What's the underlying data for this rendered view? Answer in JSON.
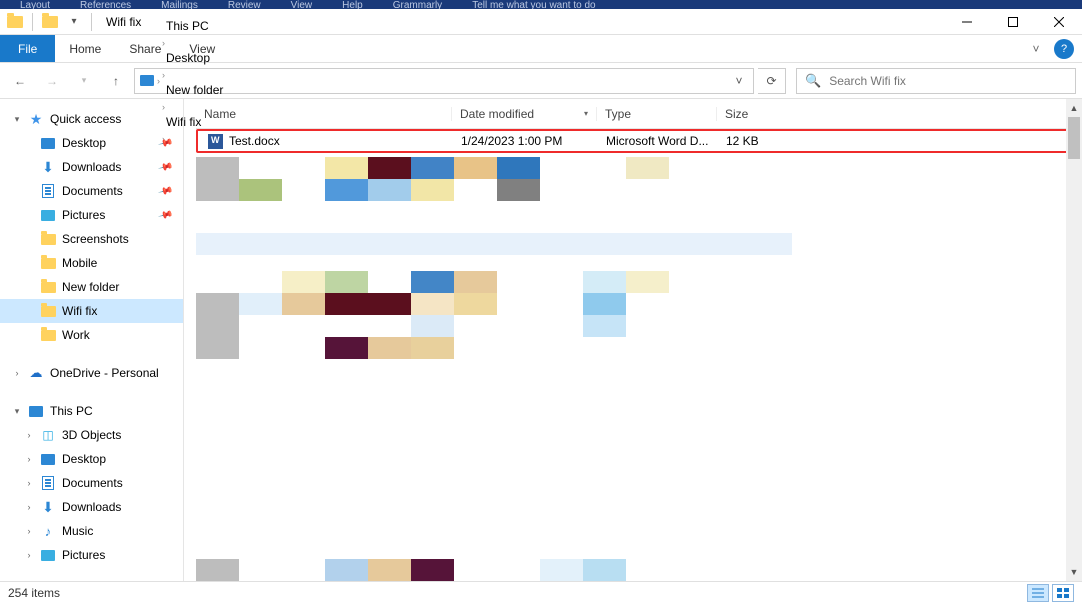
{
  "word_ribbon": [
    "Layout",
    "References",
    "Mailings",
    "Review",
    "View",
    "Help",
    "Grammarly",
    "Tell me what you want to do"
  ],
  "titlebar": {
    "title": "Wifi fix"
  },
  "ribbon": {
    "file": "File",
    "tabs": [
      "Home",
      "Share",
      "View"
    ]
  },
  "breadcrumbs": [
    "This PC",
    "Desktop",
    "New folder",
    "Wifi fix"
  ],
  "search": {
    "placeholder": "Search Wifi fix"
  },
  "nav": {
    "quick_access": "Quick access",
    "qa_items": [
      {
        "label": "Desktop",
        "pin": true,
        "ico": "desk"
      },
      {
        "label": "Downloads",
        "pin": true,
        "ico": "dl"
      },
      {
        "label": "Documents",
        "pin": true,
        "ico": "doc"
      },
      {
        "label": "Pictures",
        "pin": true,
        "ico": "pic"
      },
      {
        "label": "Screenshots",
        "pin": false,
        "ico": "folder"
      },
      {
        "label": "Mobile",
        "pin": false,
        "ico": "folder"
      },
      {
        "label": "New folder",
        "pin": false,
        "ico": "folder"
      },
      {
        "label": "Wifi fix",
        "pin": false,
        "ico": "folder",
        "sel": true
      },
      {
        "label": "Work",
        "pin": false,
        "ico": "folder"
      }
    ],
    "onedrive": "OneDrive - Personal",
    "this_pc": "This PC",
    "pc_items": [
      {
        "label": "3D Objects",
        "ico": "3d"
      },
      {
        "label": "Desktop",
        "ico": "desk"
      },
      {
        "label": "Documents",
        "ico": "doc"
      },
      {
        "label": "Downloads",
        "ico": "dl"
      },
      {
        "label": "Music",
        "ico": "music"
      },
      {
        "label": "Pictures",
        "ico": "pic"
      }
    ]
  },
  "columns": {
    "name": "Name",
    "date": "Date modified",
    "type": "Type",
    "size": "Size"
  },
  "file": {
    "name": "Test.docx",
    "date": "1/24/2023 1:00 PM",
    "type": "Microsoft Word D...",
    "size": "12 KB"
  },
  "status": {
    "count": "254 items"
  },
  "colors": {
    "px1": [
      [
        "#bdbdbd",
        "",
        "",
        "#f3e7a7",
        "#5b0f1e",
        "#4183c6",
        "#e8c387",
        "#2f77bc",
        "",
        "",
        "#f0e9c3"
      ],
      [
        "#bdbdbd",
        "#abc37c",
        "",
        "#5199db",
        "#a2cceb",
        "#f2e6a7",
        "",
        "#808080",
        "",
        ""
      ]
    ],
    "px_strip": "#e7f1fb",
    "px2": [
      [
        "",
        "",
        "#f6efc7",
        "#bed5a3",
        "",
        "#4386c7",
        "#e6c99b",
        "",
        "",
        "#d4ecf7",
        "#f5efcb"
      ],
      [
        "#bdbdbd",
        "#e1effa",
        "#e6c99b",
        "#5b0f1e",
        "#5b0f1e",
        "#f5e5c5",
        "#eed89e",
        "",
        "",
        "#8fcaed"
      ],
      [
        "#bdbdbd",
        "",
        "",
        "",
        "",
        "#dbeaf7",
        "",
        "",
        "",
        "#c6e4f7"
      ],
      [
        "#bdbdbd",
        "",
        "",
        "#561439",
        "#e6c99b",
        "#e8d09c",
        "",
        "",
        "",
        ""
      ]
    ],
    "px3": [
      [
        "#bdbdbd",
        "",
        "",
        "#b2d1ec",
        "#e6c99b",
        "#561439",
        "",
        "",
        "#e3f1fa",
        "#b8def2"
      ]
    ]
  }
}
